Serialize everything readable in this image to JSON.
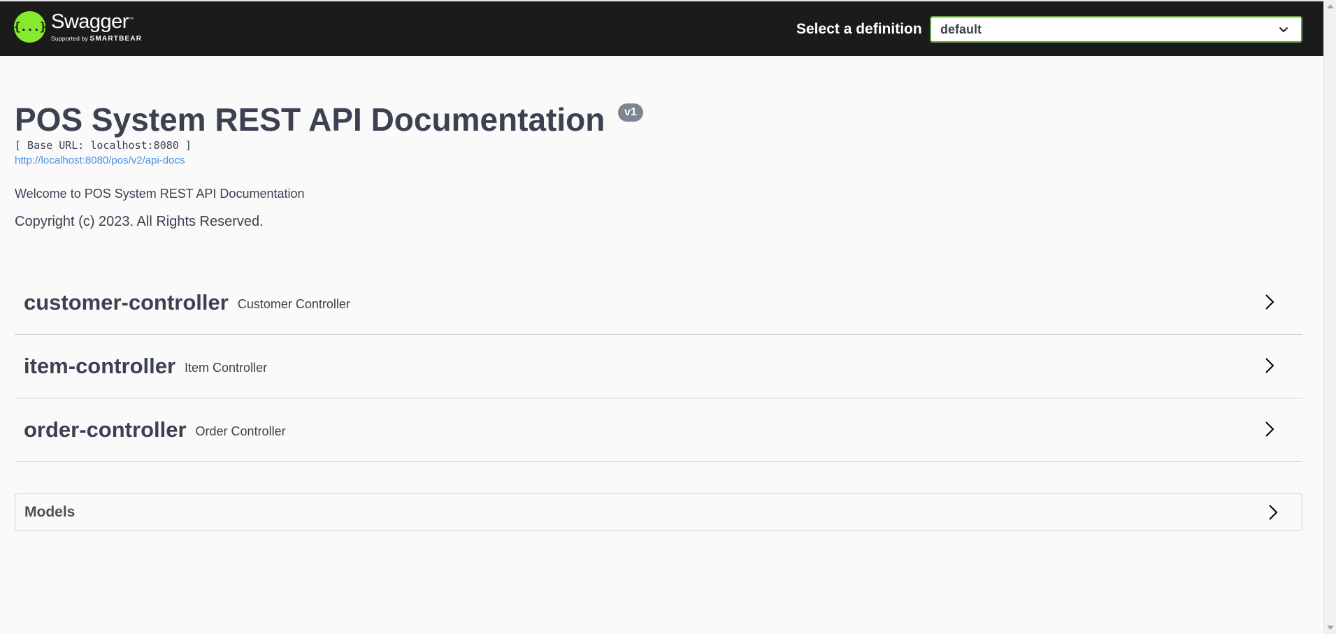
{
  "header": {
    "logo_icon": "{...}",
    "logo_name": "Swagger",
    "logo_tm": "™",
    "logo_supported": "Supported by",
    "logo_brand": "SMARTBEAR",
    "definition_label": "Select a definition",
    "definition_value": "default",
    "colors": {
      "bar": "#1b1b1b",
      "logo": "#85ea2d",
      "select_border": "#62a03f"
    }
  },
  "info": {
    "title": "POS System REST API Documentation",
    "version": "v1",
    "base_url": "[ Base URL: localhost:8080 ]",
    "docs_link": "http://localhost:8080/pos/v2/api-docs",
    "description": "Welcome to POS System REST API Documentation",
    "copyright": "Copyright (c) 2023. All Rights Reserved."
  },
  "tags": [
    {
      "name": "customer-controller",
      "description": "Customer Controller",
      "icon": "chevron-right-icon"
    },
    {
      "name": "item-controller",
      "description": "Item Controller",
      "icon": "chevron-right-icon"
    },
    {
      "name": "order-controller",
      "description": "Order Controller",
      "icon": "chevron-right-icon"
    }
  ],
  "models": {
    "title": "Models",
    "icon": "chevron-right-icon"
  }
}
